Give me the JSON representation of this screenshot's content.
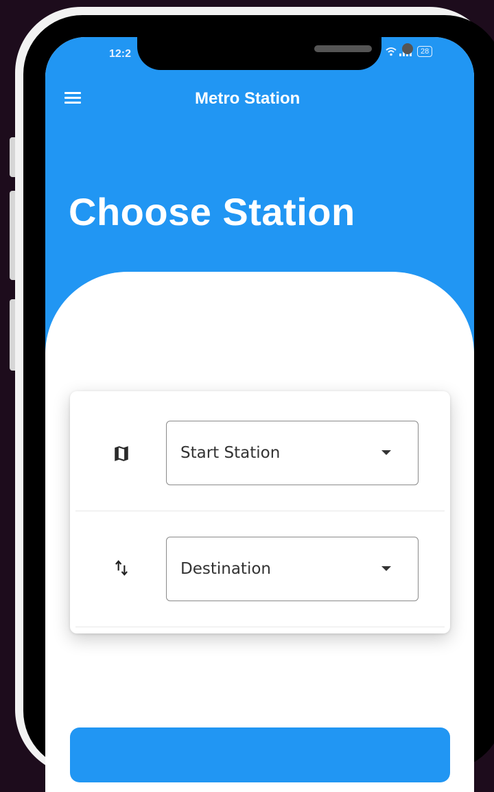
{
  "status_bar": {
    "time": "12:2",
    "battery": "28"
  },
  "toolbar": {
    "title": "Metro Station"
  },
  "page": {
    "heading": "Choose Station"
  },
  "form": {
    "start_station": {
      "icon": "map-icon",
      "value": "Start Station"
    },
    "destination": {
      "icon": "swap-vertical-icon",
      "value": "Destination"
    }
  },
  "colors": {
    "primary": "#2196f3",
    "background": "#1d0c1c"
  }
}
